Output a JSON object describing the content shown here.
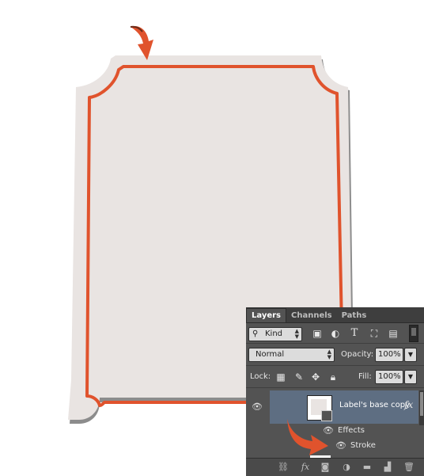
{
  "colors": {
    "label_fill": "#e9e4e2",
    "label_shadow": "#8a8a8a",
    "stroke": "#e0532d",
    "arrow": "#e0532d",
    "panel_bg": "#535353",
    "selected_layer": "#5e6e82"
  },
  "layers_panel": {
    "tabs": [
      {
        "label": "Layers",
        "active": true
      },
      {
        "label": "Channels",
        "active": false
      },
      {
        "label": "Paths",
        "active": false
      }
    ],
    "filter": {
      "kind_label": "Kind",
      "icons": [
        "search-icon",
        "pixel-layer-filter-icon",
        "adjustment-layer-filter-icon",
        "type-layer-filter-icon",
        "shape-layer-filter-icon",
        "smart-object-filter-icon",
        "filter-toggle-icon"
      ]
    },
    "blend": {
      "mode": "Normal",
      "opacity_label": "Opacity:",
      "opacity_value": "100%"
    },
    "lock": {
      "label": "Lock:",
      "icons": [
        "lock-transparent-pixels-icon",
        "lock-image-pixels-icon",
        "lock-position-icon",
        "lock-all-icon"
      ],
      "fill_label": "Fill:",
      "fill_value": "100%"
    },
    "layer": {
      "name": "Label's base copy",
      "fx_label": "fx",
      "effects_label": "Effects",
      "stroke_label": "Stroke"
    },
    "footer_icons": [
      "link-layers-icon",
      "add-layer-style-icon",
      "add-mask-icon",
      "new-adjustment-layer-icon",
      "new-group-icon",
      "new-layer-icon",
      "delete-layer-icon"
    ]
  }
}
